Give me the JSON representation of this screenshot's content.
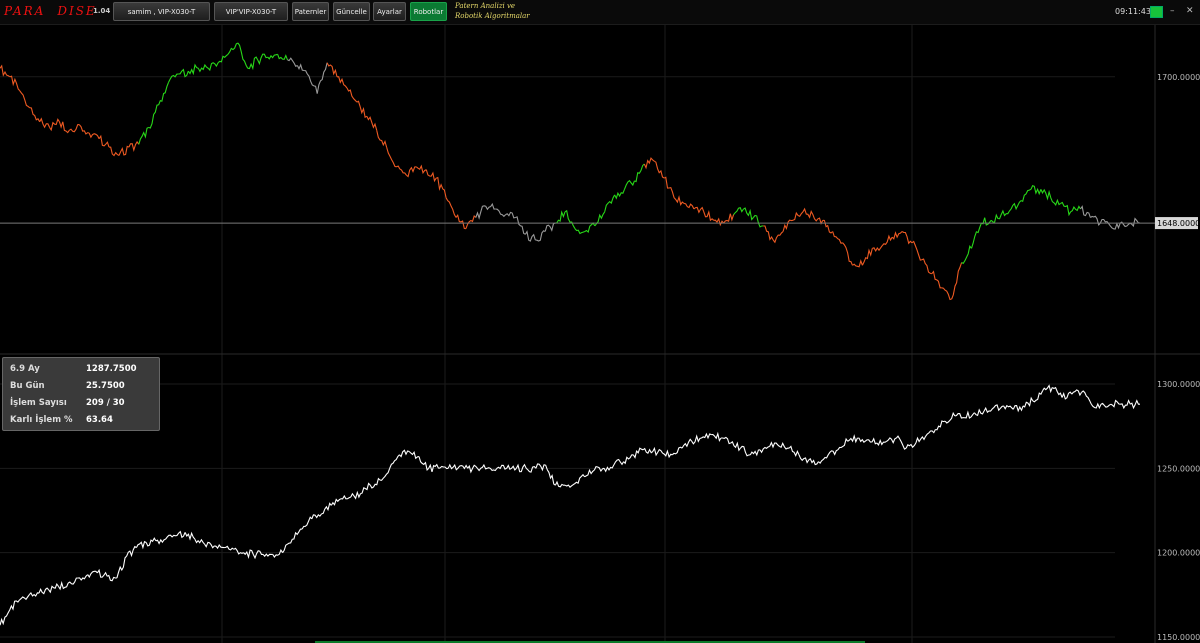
{
  "app": {
    "logo_left": "PARA",
    "logo_right": "DISE",
    "version": "1.04",
    "tagline_line1": "Patern Analizi ve",
    "tagline_line2": "Robotik Algoritmalar",
    "clock": "09:11:43",
    "status_color": "#17c23b"
  },
  "toolbar": {
    "user_account": "samim ,  VIP-X030-T",
    "symbol": "VIP'VIP-X030-T",
    "patterns": "Paternler",
    "update": "Güncelle",
    "settings": "Ayarlar",
    "robots": "Robotlar"
  },
  "window_controls": {
    "minimize": "–",
    "close": "✕"
  },
  "stats": [
    {
      "label": "6.9 Ay",
      "value": "1287.7500"
    },
    {
      "label": "Bu Gün",
      "value": "25.7500"
    },
    {
      "label": "İşlem Sayısı",
      "value": "209 / 30"
    },
    {
      "label": "Karlı İşlem %",
      "value": "63.64"
    }
  ],
  "chart_data": [
    {
      "type": "line",
      "yticks": [
        "1700.0000"
      ],
      "current_price_label": "1648.0000",
      "current_price": 1648,
      "ylim": [
        1610,
        1712
      ],
      "colors": {
        "up": "#28d818",
        "down": "#ee5a22",
        "flat": "#9a9a9a",
        "price_line": "#7a7a7a",
        "price_box": "#d8d8d8"
      },
      "series": [
        {
          "values": [
            1703,
            1700,
            1695,
            1689,
            1684,
            1682,
            1684,
            1681,
            1683,
            1680,
            1678,
            1675,
            1672,
            1675,
            1676,
            1682,
            1690,
            1698,
            1701,
            1702,
            1703,
            1703,
            1705,
            1708,
            1712,
            1703,
            1706,
            1707,
            1708,
            1706,
            1704,
            1701,
            1694,
            1705,
            1700,
            1696,
            1691,
            1686,
            1681,
            1675,
            1668,
            1665,
            1668,
            1667,
            1664,
            1657,
            1650,
            1646,
            1650,
            1654,
            1653,
            1651,
            1650,
            1644,
            1642,
            1645,
            1648,
            1652,
            1646,
            1645,
            1647,
            1652,
            1658,
            1660,
            1663,
            1669,
            1670,
            1664,
            1657,
            1655,
            1653,
            1652,
            1649,
            1648,
            1651,
            1653,
            1650,
            1647,
            1642,
            1645,
            1649,
            1652,
            1651,
            1649,
            1645,
            1641,
            1633,
            1633,
            1639,
            1640,
            1643,
            1645,
            1641,
            1635,
            1630,
            1625,
            1621,
            1634,
            1639,
            1648,
            1649,
            1651,
            1653,
            1656,
            1660,
            1660,
            1657,
            1655,
            1652,
            1653,
            1650,
            1648,
            1647,
            1648,
            1648,
            1648
          ],
          "colors": [
            "d",
            "d",
            "d",
            "d",
            "d",
            "d",
            "d",
            "d",
            "d",
            "d",
            "d",
            "d",
            "d",
            "d",
            "u",
            "u",
            "u",
            "u",
            "u",
            "u",
            "u",
            "u",
            "u",
            "u",
            "u",
            "u",
            "u",
            "u",
            "u",
            "f",
            "f",
            "f",
            "f",
            "d",
            "d",
            "d",
            "d",
            "d",
            "d",
            "d",
            "d",
            "d",
            "d",
            "d",
            "d",
            "d",
            "d",
            "d",
            "f",
            "f",
            "f",
            "f",
            "f",
            "f",
            "f",
            "f",
            "u",
            "u",
            "u",
            "u",
            "u",
            "u",
            "u",
            "u",
            "u",
            "d",
            "d",
            "d",
            "d",
            "d",
            "d",
            "d",
            "d",
            "d",
            "u",
            "u",
            "u",
            "d",
            "d",
            "d",
            "d",
            "d",
            "d",
            "d",
            "d",
            "d",
            "d",
            "d",
            "d",
            "d",
            "d",
            "d",
            "d",
            "d",
            "d",
            "d",
            "d",
            "u",
            "u",
            "u",
            "u",
            "u",
            "u",
            "u",
            "u",
            "u",
            "u",
            "u",
            "u",
            "f",
            "f",
            "f",
            "f",
            "f",
            "f",
            "f"
          ]
        }
      ]
    },
    {
      "type": "line",
      "yticks": [
        "1300.0000",
        "1250.0000",
        "1200.0000",
        "1150.0000"
      ],
      "ylim": [
        1150,
        1300
      ],
      "colors": {
        "line": "#ffffff"
      },
      "series": [
        {
          "values": [
            1157,
            1166,
            1172,
            1175,
            1176,
            1178,
            1180,
            1182,
            1185,
            1187,
            1188,
            1186,
            1185,
            1198,
            1203,
            1206,
            1207,
            1208,
            1210,
            1212,
            1208,
            1205,
            1204,
            1203,
            1202,
            1200,
            1199,
            1199,
            1199,
            1200,
            1208,
            1214,
            1220,
            1223,
            1228,
            1232,
            1233,
            1235,
            1240,
            1243,
            1250,
            1258,
            1260,
            1257,
            1250,
            1250,
            1250,
            1250,
            1250,
            1250,
            1250,
            1250,
            1250,
            1250,
            1250,
            1250,
            1252,
            1240,
            1240,
            1241,
            1245,
            1249,
            1250,
            1252,
            1254,
            1258,
            1261,
            1260,
            1259,
            1258,
            1262,
            1266,
            1268,
            1270,
            1268,
            1265,
            1262,
            1258,
            1261,
            1263,
            1263,
            1262,
            1258,
            1255,
            1254,
            1258,
            1261,
            1266,
            1268,
            1267,
            1265,
            1266,
            1268,
            1262,
            1265,
            1269,
            1273,
            1278,
            1281,
            1280,
            1283,
            1284,
            1286,
            1287,
            1285,
            1287,
            1290,
            1296,
            1298,
            1292,
            1294,
            1295,
            1288,
            1288,
            1288,
            1288,
            1288,
            1288
          ]
        }
      ]
    }
  ]
}
